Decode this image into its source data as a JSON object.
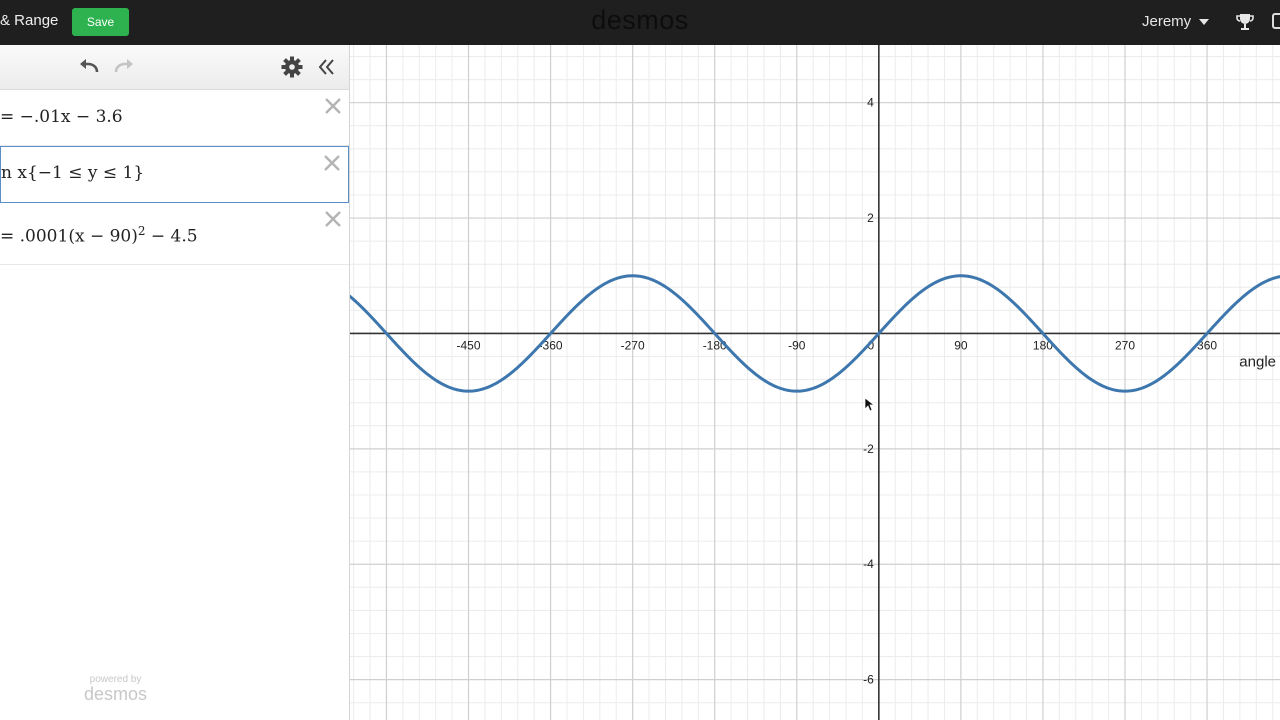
{
  "topbar": {
    "title": "& Range",
    "save_label": "Save",
    "logo": "desmos",
    "user_name": "Jeremy"
  },
  "expressions": [
    {
      "text": "= −.01x − 3.6"
    },
    {
      "text": "n x{−1 ≤ y ≤ 1}"
    },
    {
      "text_main": "= .0001(x − 90)",
      "exponent": "2",
      "text_tail": " − 4.5"
    }
  ],
  "branding": {
    "powered_by": "powered by",
    "logo": "desmos"
  },
  "chart_data": {
    "type": "line",
    "xlabel": "angle",
    "ylabel": "",
    "xlim": [
      -580,
      440
    ],
    "ylim": [
      -6.7,
      5.0
    ],
    "x_ticks": [
      -450,
      -360,
      -270,
      -180,
      -90,
      0,
      90,
      180,
      270,
      360
    ],
    "x_tick_labels": [
      "-450",
      "-360",
      "-270",
      "-180",
      "-90",
      "0",
      "90",
      "180",
      "270",
      "360"
    ],
    "y_ticks": [
      4,
      2,
      -2,
      -4,
      -6
    ],
    "y_tick_labels": [
      "4",
      "2",
      "-2",
      "-4",
      "-6"
    ],
    "grid": true,
    "series": [
      {
        "function": "sin",
        "domain": [
          -580,
          440
        ],
        "amplitude": 1,
        "color": "#3d77ad",
        "x": [
          -540,
          -450,
          -360,
          -270,
          -180,
          -90,
          0,
          90,
          180,
          270,
          360
        ],
        "y": [
          0,
          -1,
          0,
          1,
          0,
          -1,
          0,
          1,
          0,
          -1,
          0
        ]
      }
    ]
  }
}
